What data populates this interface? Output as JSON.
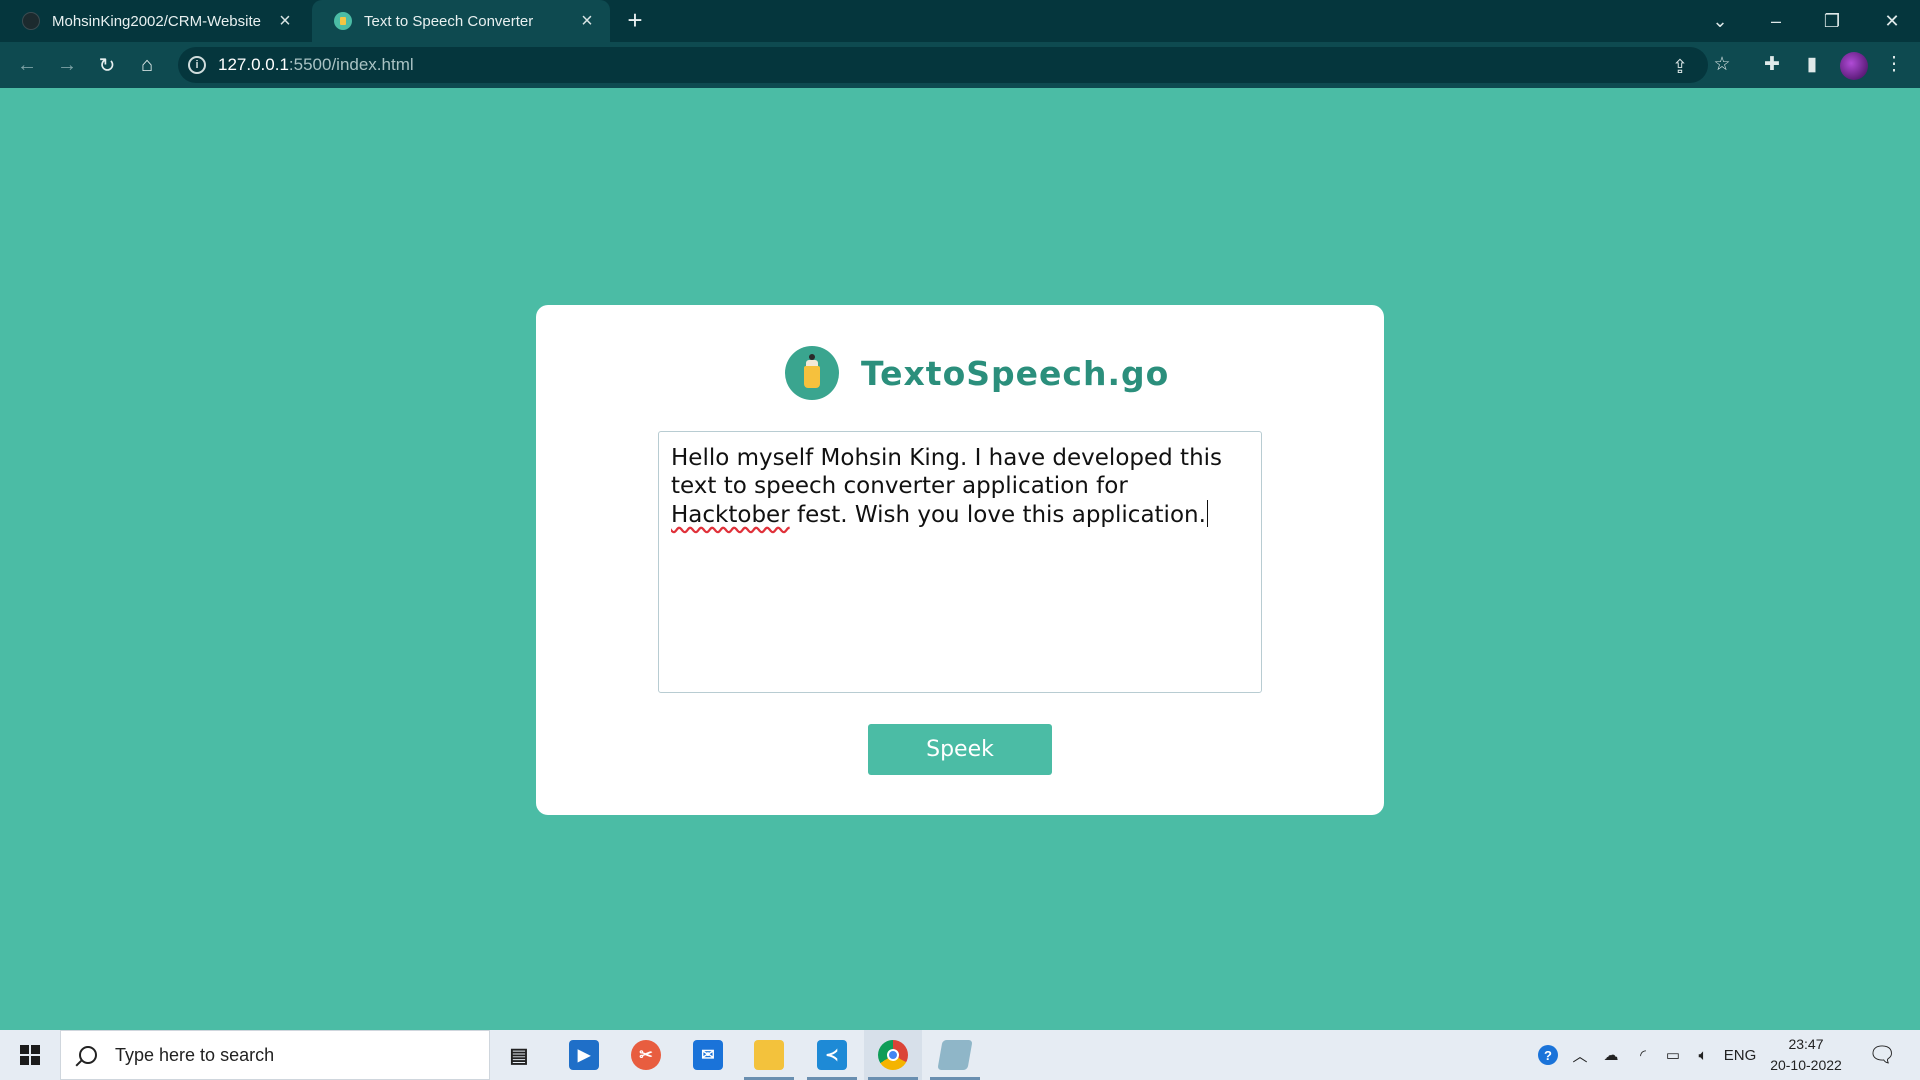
{
  "browser": {
    "tabs": [
      {
        "title": "MohsinKing2002/CRM-Website",
        "active": false
      },
      {
        "title": "Text to Speech Converter",
        "active": true
      }
    ],
    "new_tab_label": "+",
    "url_host": "127.0.0.1",
    "url_path": ":5500/index.html"
  },
  "app": {
    "brand": "TextoSpeech.go",
    "textarea_value_before": "Hello myself Mohsin King. I have developed this text to speech converter application for ",
    "textarea_misspelled": "Hacktober",
    "textarea_value_after": " fest. Wish you love this application.",
    "speak_button": "Speek",
    "colors": {
      "accent": "#4bbca5",
      "brand_text": "#2b8f7c",
      "card": "#ffffff"
    }
  },
  "taskbar": {
    "search_placeholder": "Type here to search",
    "language": "ENG",
    "time": "23:47",
    "date": "20-10-2022",
    "pinned_apps": [
      "task-view",
      "media-player",
      "snipping-tool",
      "mail",
      "file-explorer",
      "vs-code",
      "chrome",
      "notes"
    ]
  }
}
